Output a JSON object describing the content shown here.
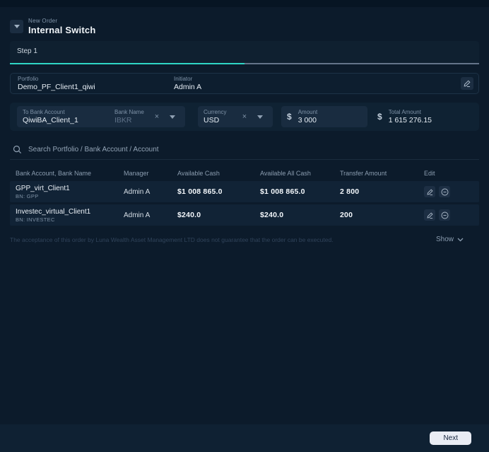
{
  "header": {
    "subtitle": "New Order",
    "title": "Internal Switch"
  },
  "step": {
    "label": "Step 1",
    "progress_percent": 50
  },
  "order_info": {
    "portfolio_label": "Portfolio",
    "portfolio_value": "Demo_PF_Client1_qiwi",
    "initiator_label": "Initiator",
    "initiator_value": "Admin A"
  },
  "transfer_form": {
    "to_bank_account_label": "To Bank Account",
    "to_bank_account_value": "QiwiBA_Client_1",
    "bank_name_label": "Bank Name",
    "bank_name_value": "IBKR",
    "currency_label": "Currency",
    "currency_value": "USD",
    "clear_symbol": "×",
    "amount_label": "Amount",
    "amount_value": "3 000",
    "amount_currency_symbol": "$",
    "total_amount_label": "Total Amount",
    "total_amount_value": "1 615 276.15",
    "total_currency_symbol": "$"
  },
  "search": {
    "placeholder": "Search Portfolio / Bank Account / Account"
  },
  "table": {
    "columns": [
      "Bank Account, Bank Name",
      "Manager",
      "Available Cash",
      "Available All Cash",
      "Transfer Amount",
      "Edit"
    ],
    "rows": [
      {
        "bank_account": "GPP_virt_Client1",
        "bank_name": "BN: GPP",
        "manager": "Admin A",
        "available_cash": "$1 008 865.0",
        "available_all_cash": "$1 008 865.0",
        "transfer_amount": "2 800"
      },
      {
        "bank_account": "Investec_virtual_Client1",
        "bank_name": "BN: INVESTEC",
        "manager": "Admin A",
        "available_cash": "$240.0",
        "available_all_cash": "$240.0",
        "transfer_amount": "200"
      }
    ]
  },
  "disclaimer": "The acceptance of this order by Luna Wealth Asset Management LTD does not guarantee that the order can be executed.",
  "show_label": "Show",
  "footer": {
    "next_label": "Next"
  },
  "colors": {
    "accent_teal": "#2fd6c5",
    "background": "#0c1b2b",
    "panel": "#0f2233",
    "field": "#192c40",
    "row": "#112336",
    "text_primary": "#eef3f8",
    "text_muted": "#8296ab",
    "next_button_bg": "#e9ecf4"
  }
}
